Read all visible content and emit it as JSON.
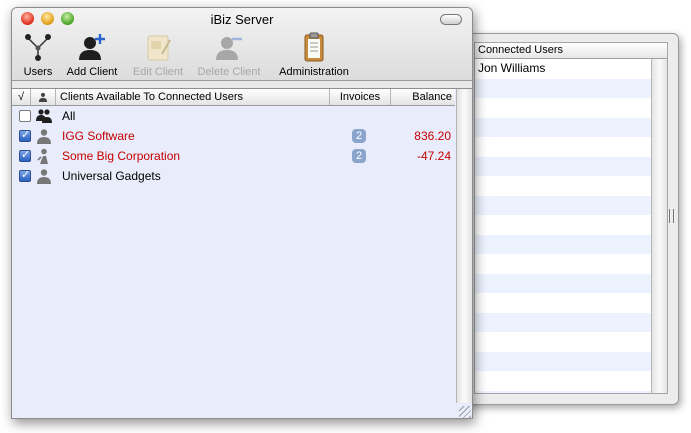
{
  "window": {
    "title": "iBiz Server"
  },
  "toolbar": {
    "items": [
      {
        "label": "Users",
        "icon": "users-network-icon",
        "enabled": true
      },
      {
        "label": "Add Client",
        "icon": "add-client-icon",
        "enabled": true
      },
      {
        "label": "Edit Client",
        "icon": "edit-client-icon",
        "enabled": false
      },
      {
        "label": "Delete Client",
        "icon": "delete-client-icon",
        "enabled": false
      },
      {
        "label": "Administration",
        "icon": "clipboard-icon",
        "enabled": true
      }
    ]
  },
  "table": {
    "columns": {
      "check": "√",
      "type": "person-icon",
      "name": "Clients Available To Connected Users",
      "invoices": "Invoices",
      "balance": "Balance"
    },
    "rows": [
      {
        "checked": false,
        "name": "All",
        "invoices": "",
        "balance": "",
        "highlight": false
      },
      {
        "checked": true,
        "name": "IGG Software",
        "invoices": "2",
        "balance": "836.20",
        "highlight": true
      },
      {
        "checked": true,
        "name": "Some Big Corporation",
        "invoices": "2",
        "balance": "-47.24",
        "highlight": true
      },
      {
        "checked": true,
        "name": "Universal Gadgets",
        "invoices": "",
        "balance": "",
        "highlight": false
      }
    ]
  },
  "drawer": {
    "header": "Connected Users",
    "users": [
      "Jon Williams"
    ]
  },
  "colors": {
    "overdue": "#c40000",
    "badge": "#8aa4cc",
    "table_bg": "#e9edfb",
    "drawer_stripe": "#edf3fe"
  }
}
